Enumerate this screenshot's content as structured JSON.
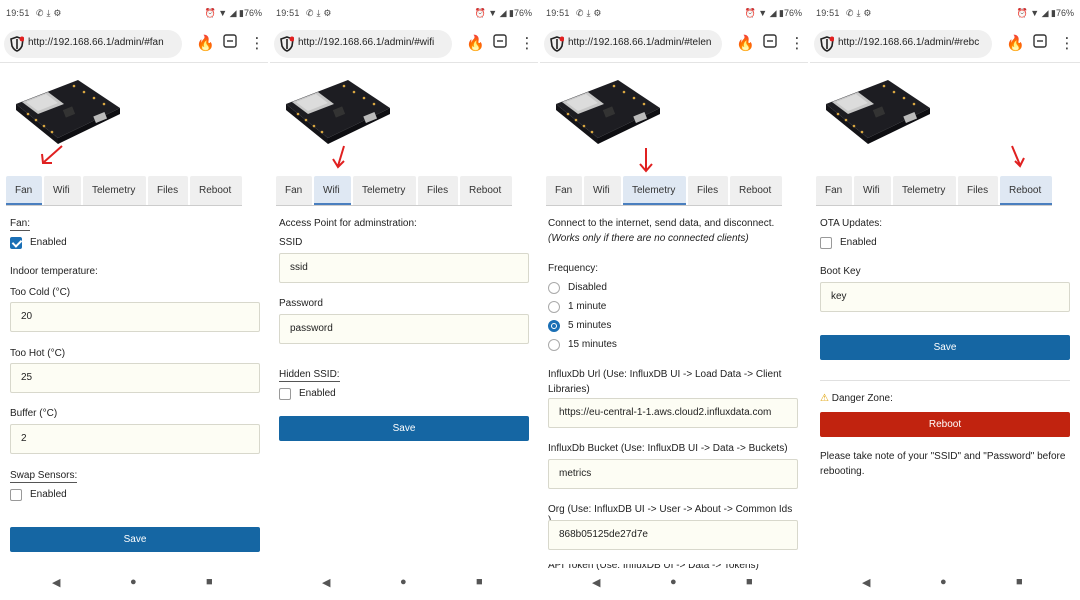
{
  "status": {
    "time": "19:51",
    "battery": "76%"
  },
  "colors": {
    "primary": "#1566a3",
    "danger": "#c1230f",
    "tab_active": "#dfe8f3",
    "input_bg": "#fdfdf4"
  },
  "tabs": [
    "Fan",
    "Wifi",
    "Telemetry",
    "Files",
    "Reboot"
  ],
  "panels": [
    {
      "url": "http://192.168.66.1/admin/#fan"
    },
    {
      "url": "http://192.168.66.1/admin/#wifi"
    },
    {
      "url": "http://192.168.66.1/admin/#telen"
    },
    {
      "url": "http://192.168.66.1/admin/#rebc"
    }
  ],
  "fan": {
    "fan_label": "Fan:",
    "enabled": "Enabled",
    "indoor_label": "Indoor temperature:",
    "too_cold_label": "Too Cold (°C)",
    "too_cold_value": "20",
    "too_hot_label": "Too Hot (°C)",
    "too_hot_value": "25",
    "buffer_label": "Buffer (°C)",
    "buffer_value": "2",
    "swap_label": "Swap Sensors:",
    "swap_enabled": "Enabled",
    "save": "Save"
  },
  "wifi": {
    "ap_label": "Access Point for adminstration:",
    "ssid_label": "SSID",
    "ssid_value": "ssid",
    "password_label": "Password",
    "password_value": "password",
    "hidden_label": "Hidden SSID:",
    "hidden_enabled": "Enabled",
    "save": "Save"
  },
  "telemetry": {
    "intro": "Connect to the internet, send data, and disconnect.",
    "note": "(Works only if there are no connected clients)",
    "frequency_label": "Frequency:",
    "frequency_options": [
      "Disabled",
      "1 minute",
      "5 minutes",
      "15 minutes"
    ],
    "frequency_selected": "5 minutes",
    "url_label": "InfluxDb Url (Use: InfluxDB UI -> Load Data -> Client Libraries)",
    "url_value": "https://eu-central-1-1.aws.cloud2.influxdata.com",
    "bucket_label": "InfluxDb Bucket (Use: InfluxDB UI -> Data -> Buckets)",
    "bucket_value": "metrics",
    "org_label": "Org (Use: InfluxDB UI -> User -> About -> Common Ids )",
    "org_value": "868b05125de27d7e",
    "token_label": "API Token (Use: InfluxDB UI -> Data -> Tokens)"
  },
  "reboot": {
    "ota_label": "OTA Updates:",
    "ota_enabled": "Enabled",
    "boot_key_label": "Boot Key",
    "boot_key_value": "key",
    "save": "Save",
    "danger_label": "Danger Zone:",
    "reboot_button": "Reboot",
    "note": "Please take note of your \"SSID\" and \"Password\" before rebooting."
  }
}
